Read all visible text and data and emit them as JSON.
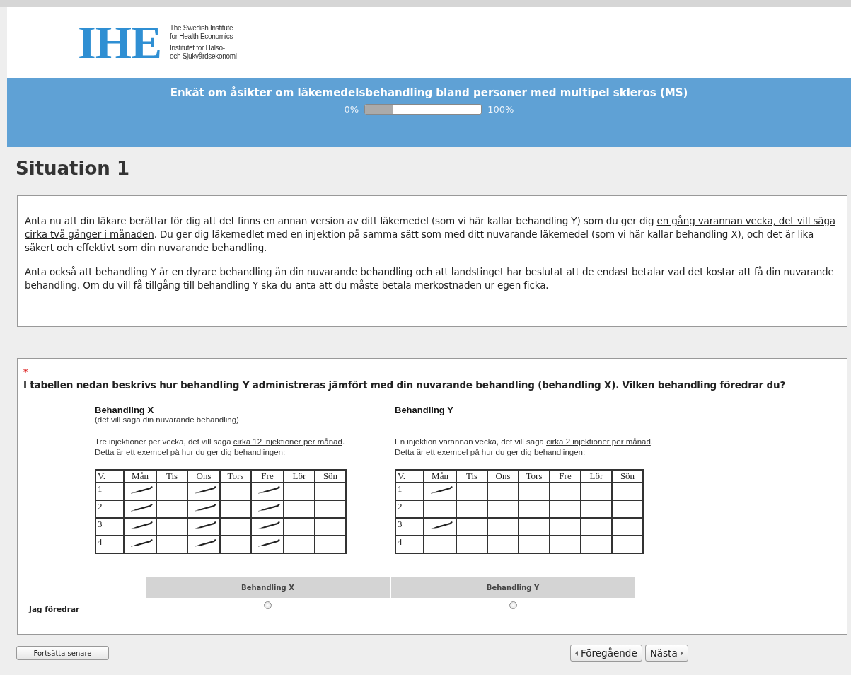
{
  "logo": {
    "mark": "IHE",
    "lines": [
      "The Swedish Institute",
      "for Health Economics",
      "Institutet för Hälso-",
      "och Sjukvårdsekonomi"
    ]
  },
  "banner": {
    "title": "Enkät om åsikter om läkemedelsbehandling bland personer med multipel skleros (MS)",
    "progress": {
      "start_label": "0%",
      "end_label": "100%",
      "level": 0.24
    }
  },
  "page_title": "Situation 1",
  "intro": {
    "paragraphs": [
      {
        "parts": [
          {
            "text": "Anta nu att din läkare berättar för dig att det finns en annan version av ditt läkemedel (som vi här kallar behandling Y) som du ger dig ",
            "underlined": false
          },
          {
            "text": "en gång varannan vecka, det vill säga cirka två gånger i månaden",
            "underlined": true
          },
          {
            "text": ". Du ger dig läkemedlet med en injektion på samma sätt som med ditt nuvarande läkemedel (som vi här kallar behandling X), och det är lika säkert och effektivt som din nuvarande behandling.",
            "underlined": false
          }
        ]
      },
      {
        "parts": [
          {
            "text": "Anta också att behandling Y är en dyrare behandling än din nuvarande behandling och att landstinget har beslutat att de endast betalar vad det kostar att få din nuvarande behandling. Om du vill få tillgång till behandling Y ska du anta att du måste betala merkostnaden ur egen ficka.",
            "underlined": false
          }
        ]
      }
    ]
  },
  "question": {
    "required_mark": "*",
    "text": "I tabellen nedan beskrivs hur behandling Y administreras jämfört med din nuvarande behandling (behandling X). Vilken behandling föredrar du?",
    "treatments": [
      {
        "title": "Behandling X",
        "subtitle": "(det vill säga din nuvarande behandling)",
        "description": [
          {
            "text": "Tre injektioner per vecka, det vill säga ",
            "underlined": false
          },
          {
            "text": "cirka 12 injektioner per månad",
            "underlined": true
          },
          {
            "text": ".  Detta är ett exempel på hur du ger dig behandlingen:",
            "underlined": false
          }
        ],
        "schedule": {
          "columns": [
            "V.",
            "Mån",
            "Tis",
            "Ons",
            "Tors",
            "Fre",
            "Lör",
            "Sön"
          ],
          "rows": [
            {
              "week": "1",
              "doses": [
                true,
                false,
                true,
                false,
                true,
                false,
                false
              ]
            },
            {
              "week": "2",
              "doses": [
                true,
                false,
                true,
                false,
                true,
                false,
                false
              ]
            },
            {
              "week": "3",
              "doses": [
                true,
                false,
                true,
                false,
                true,
                false,
                false
              ]
            },
            {
              "week": "4",
              "doses": [
                true,
                false,
                true,
                false,
                true,
                false,
                false
              ]
            }
          ]
        }
      },
      {
        "title": "Behandling Y",
        "description": [
          {
            "text": "En injektion varannan vecka, det vill säga ",
            "underlined": false
          },
          {
            "text": "cirka 2 injektioner per månad",
            "underlined": true
          },
          {
            "text": ". Detta är ett exempel på hur du ger dig behandlingen:",
            "underlined": false
          }
        ],
        "schedule": {
          "columns": [
            "V.",
            "Mån",
            "Tis",
            "Ons",
            "Tors",
            "Fre",
            "Lör",
            "Sön"
          ],
          "rows": [
            {
              "week": "1",
              "doses": [
                true,
                false,
                false,
                false,
                false,
                false,
                false
              ]
            },
            {
              "week": "2",
              "doses": [
                false,
                false,
                false,
                false,
                false,
                false,
                false
              ]
            },
            {
              "week": "3",
              "doses": [
                true,
                false,
                false,
                false,
                false,
                false,
                false
              ]
            },
            {
              "week": "4",
              "doses": [
                false,
                false,
                false,
                false,
                false,
                false,
                false
              ]
            }
          ]
        }
      }
    ],
    "choice": {
      "row_label": "Jag föredrar",
      "options": [
        {
          "label": "Behandling X",
          "selected": false
        },
        {
          "label": "Behandling Y",
          "selected": false
        }
      ]
    }
  },
  "buttons": {
    "later": "Fortsätta senare",
    "previous": "Föregående",
    "next": "Nästa"
  }
}
